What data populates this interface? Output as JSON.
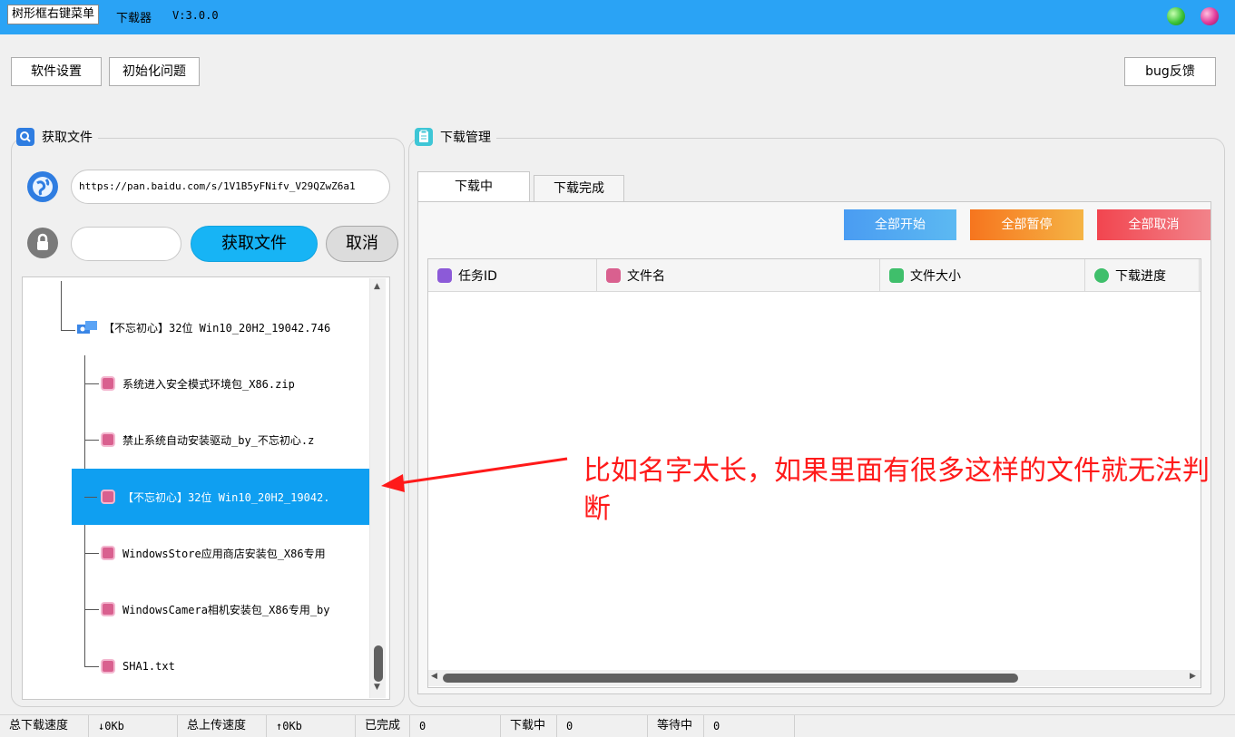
{
  "window": {
    "tooltip": "树形框右键菜单",
    "title": "下载器",
    "version": "V:3.0.0"
  },
  "toolbar": {
    "settings_label": "软件设置",
    "init_label": "初始化问题",
    "bug_label": "bug反馈"
  },
  "fetch_panel": {
    "title": "获取文件",
    "url_value": "https://pan.baidu.com/s/1V1B5yFNifv_V29QZwZ6a1",
    "password_value": "",
    "fetch_button": "获取文件",
    "cancel_button": "取消"
  },
  "tree": {
    "root": "【不忘初心】32位 Win10_20H2_19042.746",
    "children": [
      "系统进入安全模式环境包_X86.zip",
      "禁止系统自动安装驱动_by_不忘初心.z",
      "【不忘初心】32位 Win10_20H2_19042.",
      "WindowsStore应用商店安装包_X86专用",
      "WindowsCamera相机安装包_X86专用_by",
      "SHA1.txt"
    ]
  },
  "download_panel": {
    "title": "下载管理",
    "tabs": [
      "下载中",
      "下载完成"
    ],
    "start_all": "全部开始",
    "pause_all": "全部暂停",
    "cancel_all": "全部取消",
    "columns": [
      "任务ID",
      "文件名",
      "文件大小",
      "下载进度"
    ]
  },
  "annotation": {
    "text": "比如名字太长，如果里面有很多这样的文件就无法判断"
  },
  "status": {
    "down_speed_label": "总下载速度",
    "down_speed_value": "↓0Kb",
    "up_speed_label": "总上传速度",
    "up_speed_value": "↑0Kb",
    "done_label": "已完成",
    "done_value": "0",
    "downloading_label": "下载中",
    "downloading_value": "0",
    "waiting_label": "等待中",
    "waiting_value": "0"
  },
  "colors": {
    "titlebar": "#2aa3f5",
    "start_all": "#4da3f0",
    "pause_all": "#f57c1f",
    "cancel_all": "#f2525c",
    "selected_row": "#0f9ff1",
    "annotation": "#ff1a1a"
  },
  "icons": {
    "fetch_header": "search-icon",
    "download_header": "clipboard-icon",
    "url": "globe-icon",
    "password": "lock-icon",
    "tree_root": "folder-icon",
    "tree_file": "file-icon"
  }
}
